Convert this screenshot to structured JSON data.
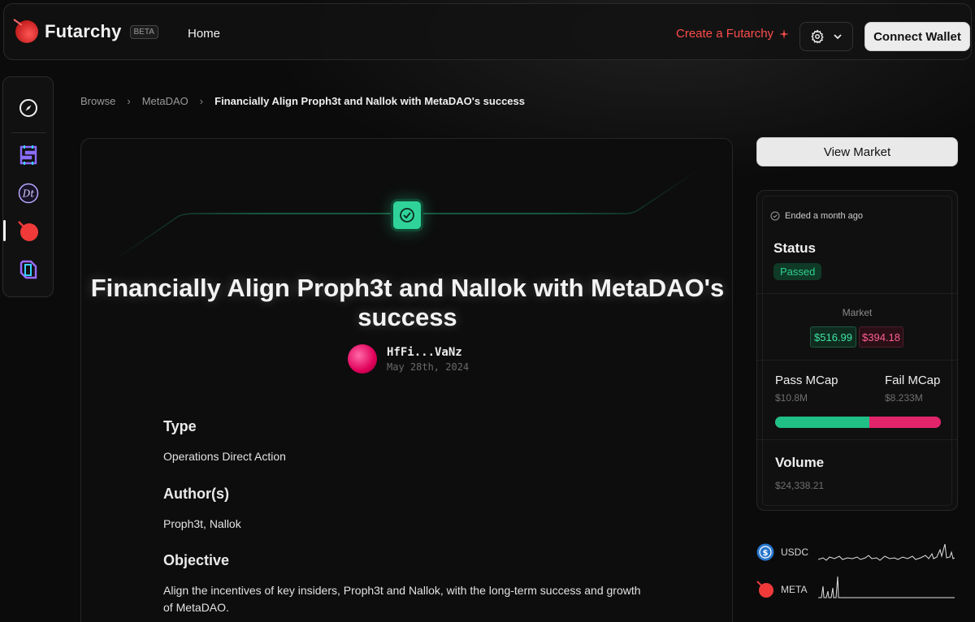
{
  "header": {
    "logo_text": "Futarchy",
    "beta": "BETA",
    "nav_home": "Home",
    "create_link": "Create a Futarchy",
    "connect_wallet": "Connect Wallet"
  },
  "sidebar": {
    "items": [
      {
        "name": "compass-icon"
      },
      {
        "name": "dao-s-icon"
      },
      {
        "name": "dl-icon"
      },
      {
        "name": "metadao-icon"
      },
      {
        "name": "cube-icon"
      }
    ]
  },
  "breadcrumb": {
    "items": [
      "Browse",
      "MetaDAO",
      "Financially Align Proph3t and Nallok with MetaDAO's success"
    ]
  },
  "proposal": {
    "title": "Financially Align Proph3t and Nallok with MetaDAO's success",
    "author": "HfFi...VaNz",
    "date": "May 28th, 2024",
    "sections": [
      {
        "heading": "Type",
        "body": "Operations Direct Action"
      },
      {
        "heading": "Author(s)",
        "body": "Proph3t, Nallok"
      },
      {
        "heading": "Objective",
        "body": "Align the incentives of key insiders, Proph3t and Nallok, with the long-term success and growth of MetaDAO."
      }
    ]
  },
  "market_panel": {
    "view_market": "View Market",
    "ended": "Ended a month ago",
    "status_label": "Status",
    "status_value": "Passed",
    "market_label": "Market",
    "pass_price": "$516.99",
    "fail_price": "$394.18",
    "pass_mcap_label": "Pass MCap",
    "pass_mcap_value": "$10.8M",
    "fail_mcap_label": "Fail MCap",
    "fail_mcap_value": "$8.233M",
    "pass_share": 0.567,
    "volume_label": "Volume",
    "volume_value": "$24,338.21"
  },
  "tokens": [
    {
      "symbol": "USDC"
    },
    {
      "symbol": "META"
    }
  ],
  "colors": {
    "accent_red": "#ff4d4d",
    "pass_green": "#1fbf86",
    "fail_pink": "#e2246a"
  }
}
